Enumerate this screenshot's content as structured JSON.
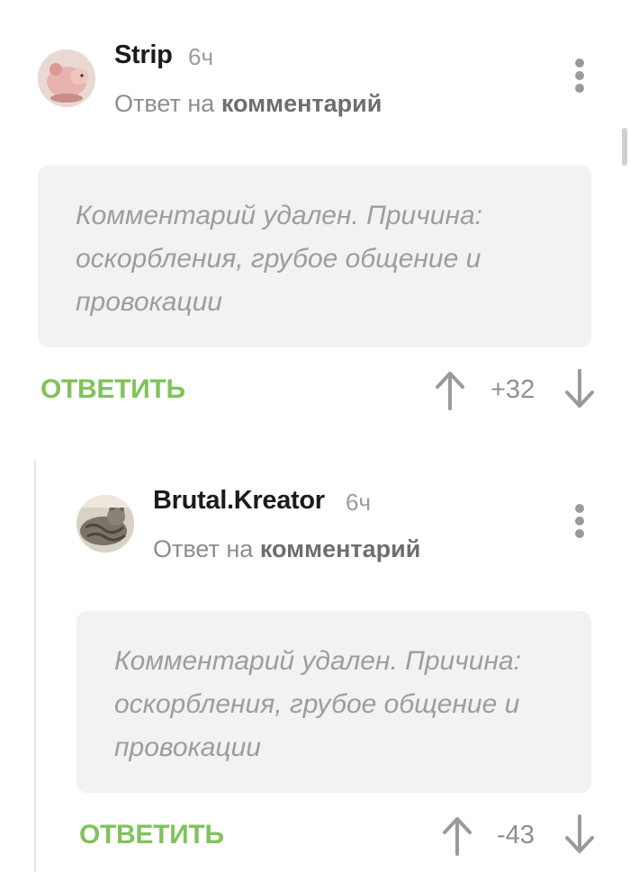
{
  "comments": [
    {
      "author": "Strip",
      "time": "6ч",
      "reply_prefix": "Ответ на",
      "reply_target": "комментарий",
      "deleted_text": "Комментарий удален. Причина: оскорбления, грубое общение и провокации",
      "reply_label": "ОТВЕТИТЬ",
      "rating": "+32",
      "avatar_icon": "hairless-rat-avatar"
    },
    {
      "author": "Brutal.Kreator",
      "time": "6ч",
      "reply_prefix": "Ответ на",
      "reply_target": "комментарий",
      "deleted_text": "Комментарий удален. Причина: оскорбления, грубое общение и провокации",
      "reply_label": "ОТВЕТИТЬ",
      "rating": "-43",
      "avatar_icon": "tabby-cat-avatar"
    }
  ],
  "colors": {
    "accent_green": "#80c35a",
    "deleted_bg": "#f2f2f2",
    "muted_text": "#9d9d9d",
    "icon_gray": "#9a9a9a"
  },
  "icons": {
    "more": "more-vertical-icon",
    "upvote": "arrow-up-icon",
    "downvote": "arrow-down-icon"
  }
}
